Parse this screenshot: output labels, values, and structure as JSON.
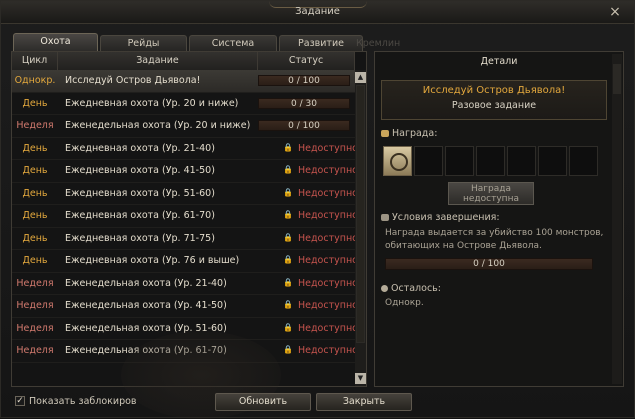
{
  "window": {
    "title": "Задание",
    "close_icon": "×"
  },
  "tabs": [
    {
      "label": "Охота",
      "active": true
    },
    {
      "label": "Рейды",
      "active": false
    },
    {
      "label": "Система",
      "active": false
    },
    {
      "label": "Развитие",
      "active": false
    }
  ],
  "tab_ghost": "Кремлин",
  "list": {
    "columns": {
      "cycle": "Цикл",
      "task": "Задание",
      "status": "Статус"
    },
    "rows": [
      {
        "cycle": "Однокр.",
        "task": "Исследуй Остров Дьявола!",
        "progress": "0 / 100",
        "status": "",
        "selected": true
      },
      {
        "cycle": "День",
        "task": "Ежедневная охота (Ур. 20 и ниже)",
        "progress": "0 / 30",
        "status": ""
      },
      {
        "cycle": "Неделя",
        "task": "Еженедельная охота (Ур. 20 и ниже)",
        "progress": "0 / 100",
        "status": ""
      },
      {
        "cycle": "День",
        "task": "Ежедневная охота (Ур. 21-40)",
        "progress": "",
        "status": "Недоступно"
      },
      {
        "cycle": "День",
        "task": "Ежедневная охота (Ур. 41-50)",
        "progress": "",
        "status": "Недоступно"
      },
      {
        "cycle": "День",
        "task": "Ежедневная охота (Ур. 51-60)",
        "progress": "",
        "status": "Недоступно"
      },
      {
        "cycle": "День",
        "task": "Ежедневная охота (Ур. 61-70)",
        "progress": "",
        "status": "Недоступно"
      },
      {
        "cycle": "День",
        "task": "Ежедневная охота (Ур. 71-75)",
        "progress": "",
        "status": "Недоступно"
      },
      {
        "cycle": "День",
        "task": "Ежедневная охота (Ур. 76 и выше)",
        "progress": "",
        "status": "Недоступно"
      },
      {
        "cycle": "Неделя",
        "task": "Еженедельная охота (Ур. 21-40)",
        "progress": "",
        "status": "Недоступно"
      },
      {
        "cycle": "Неделя",
        "task": "Еженедельная охота (Ур. 41-50)",
        "progress": "",
        "status": "Недоступно"
      },
      {
        "cycle": "Неделя",
        "task": "Еженедельная охота (Ур. 51-60)",
        "progress": "",
        "status": "Недоступно"
      },
      {
        "cycle": "Неделя",
        "task": "Еженедельная охота (Ур. 61-70)",
        "progress": "",
        "status": "Недоступно"
      }
    ]
  },
  "colors": {
    "cycle_day": "#e3a83d",
    "cycle_week": "#d27a6e",
    "cycle_once": "#e3a83d",
    "status_unavailable": "#c6544e",
    "quest_name": "#e3a83d"
  },
  "details": {
    "header": "Детали",
    "quest_name": "Исследуй Остров Дьявола!",
    "quest_type": "Разовое задание",
    "reward_label": "Награда:",
    "reward_button": [
      "Награда",
      "недоступна"
    ],
    "conditions_label": "Условия завершения:",
    "conditions_text": "Награда выдается за убийство 100 монстров, обитающих на Острове Дьявола.",
    "conditions_progress": "0 / 100",
    "remaining_label": "Осталось:",
    "remaining_value": "Однокр."
  },
  "footer": {
    "show_locked_label": "Показать заблокиров",
    "show_locked_checked": true,
    "check_mark": "✓",
    "refresh_button": "Обновить",
    "close_button": "Закрыть"
  }
}
